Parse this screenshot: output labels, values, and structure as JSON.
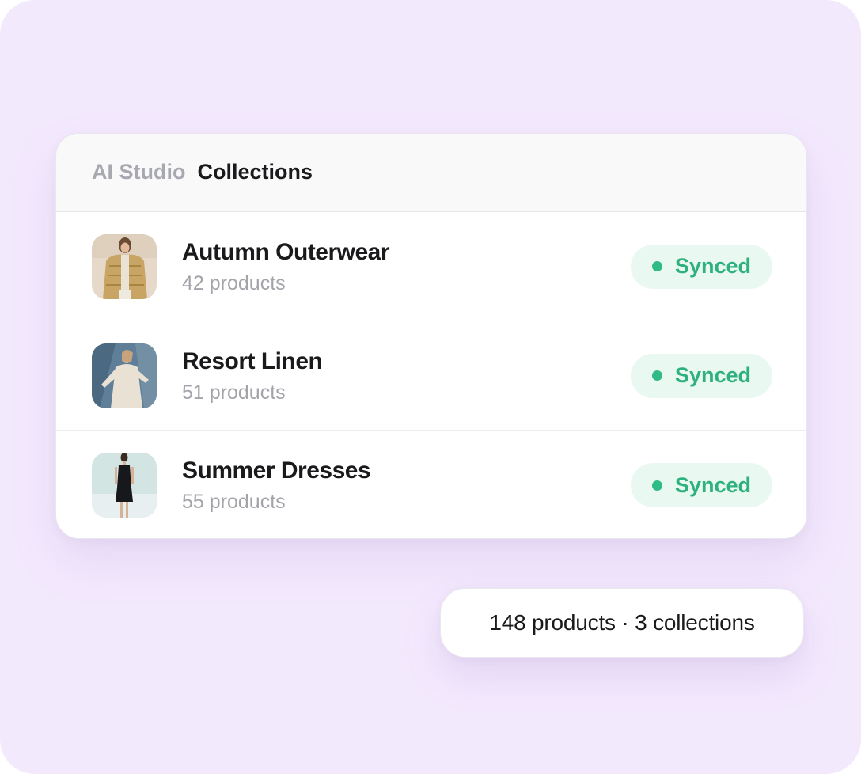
{
  "header": {
    "app_name": "AI Studio",
    "page_title": "Collections"
  },
  "collections": [
    {
      "name": "Autumn Outerwear",
      "count_label": "42 products",
      "status": "Synced",
      "thumbnail": "puffer-jacket-photo"
    },
    {
      "name": "Resort Linen",
      "count_label": "51 products",
      "status": "Synced",
      "thumbnail": "linen-dress-photo"
    },
    {
      "name": "Summer Dresses",
      "count_label": "55 products",
      "status": "Synced",
      "thumbnail": "black-dress-photo"
    }
  ],
  "summary": {
    "text": "148 products · 3 collections"
  },
  "colors": {
    "background": "#f3e9fd",
    "synced_text": "#2fb17f",
    "synced_bg": "#eaf8f2"
  }
}
